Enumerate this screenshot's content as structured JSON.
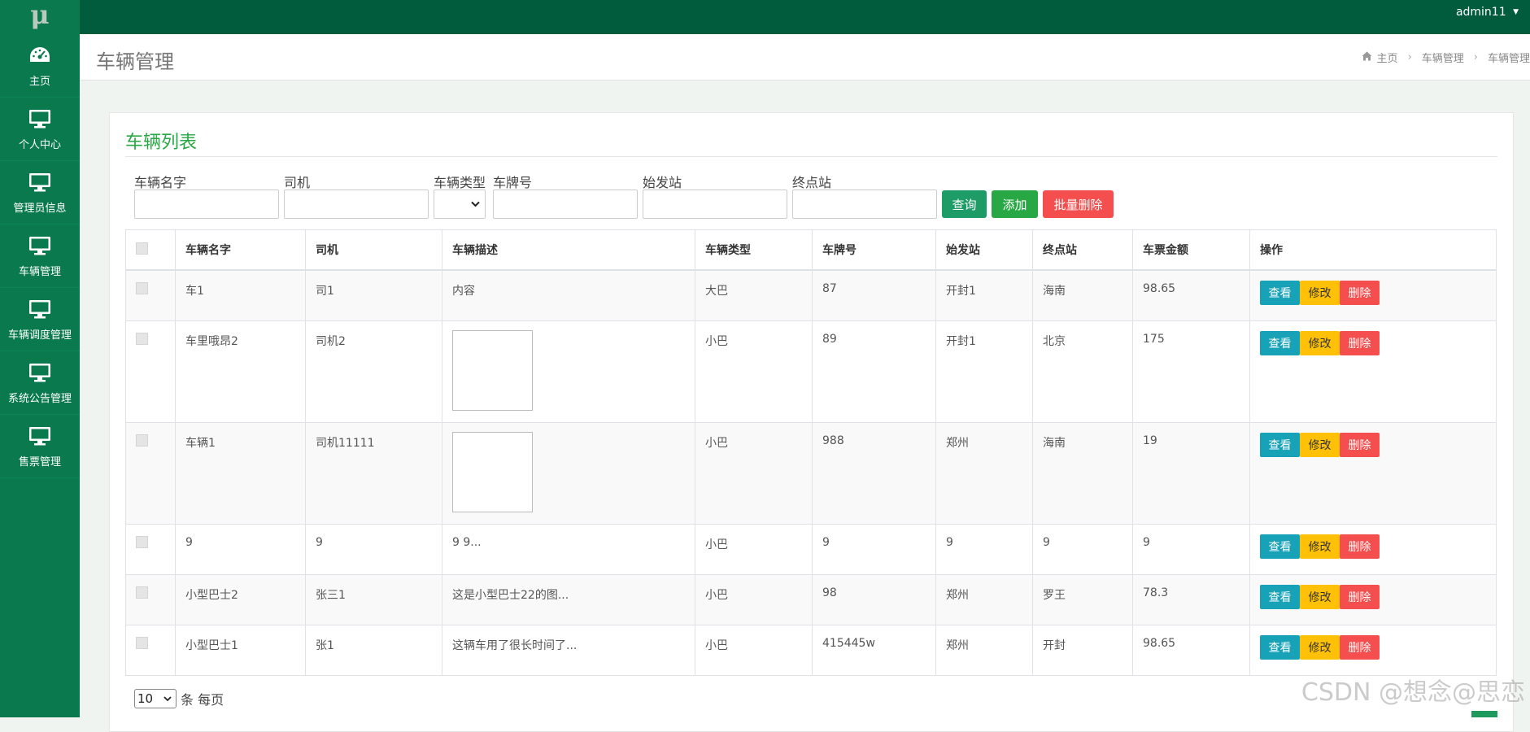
{
  "app": {
    "logo": "μ",
    "user": "admin11"
  },
  "sidebar": {
    "items": [
      {
        "label": "主页",
        "icon": "dashboard-icon"
      },
      {
        "label": "个人中心",
        "icon": "monitor-icon"
      },
      {
        "label": "管理员信息",
        "icon": "monitor-icon"
      },
      {
        "label": "车辆管理",
        "icon": "monitor-icon"
      },
      {
        "label": "车辆调度管理",
        "icon": "monitor-icon"
      },
      {
        "label": "系统公告管理",
        "icon": "monitor-icon"
      },
      {
        "label": "售票管理",
        "icon": "monitor-icon"
      }
    ]
  },
  "header": {
    "title": "车辆管理",
    "breadcrumb": [
      "主页",
      "车辆管理",
      "车辆管理"
    ]
  },
  "panel": {
    "title": "车辆列表"
  },
  "filters": {
    "name_label": "车辆名字",
    "driver_label": "司机",
    "type_label": "车辆类型",
    "plate_label": "车牌号",
    "start_label": "始发站",
    "end_label": "终点站",
    "name_value": "",
    "driver_value": "",
    "type_value": "",
    "plate_value": "",
    "start_value": "",
    "end_value": ""
  },
  "actions": {
    "search": "查询",
    "add": "添加",
    "batch_delete": "批量删除"
  },
  "table": {
    "headers": [
      "车辆名字",
      "司机",
      "车辆描述",
      "车辆类型",
      "车牌号",
      "始发站",
      "终点站",
      "车票金额",
      "操作"
    ],
    "rows": [
      {
        "name": "车1",
        "driver": "司1",
        "desc": "内容",
        "type": "大巴",
        "plate": "87",
        "start": "开封1",
        "end": "海南",
        "price": "98.65"
      },
      {
        "name": "车里哦昂2",
        "driver": "司机2",
        "desc": "",
        "type": "小巴",
        "plate": "89",
        "start": "开封1",
        "end": "北京",
        "price": "175"
      },
      {
        "name": "车辆1",
        "driver": "司机11111",
        "desc": "",
        "type": "小巴",
        "plate": "988",
        "start": "郑州",
        "end": "海南",
        "price": "19"
      },
      {
        "name": "9",
        "driver": "9",
        "desc": "9 9...",
        "type": "小巴",
        "plate": "9",
        "start": "9",
        "end": "9",
        "price": "9"
      },
      {
        "name": "小型巴士2",
        "driver": "张三1",
        "desc": "这是小型巴士22的图...",
        "type": "小巴",
        "plate": "98",
        "start": "郑州",
        "end": "罗王",
        "price": "78.3"
      },
      {
        "name": "小型巴士1",
        "driver": "张1",
        "desc": "这辆车用了很长时间了...",
        "type": "小巴",
        "plate": "415445w",
        "start": "郑州",
        "end": "开封",
        "price": "98.65"
      }
    ],
    "row_actions": {
      "view": "查看",
      "edit": "修改",
      "delete": "删除"
    }
  },
  "pager": {
    "page_size": "10",
    "suffix": "条 每页"
  },
  "watermark": "CSDN @想念@思恋",
  "colors": {
    "sidebar": "#0a7a4e",
    "topbar": "#005c3c",
    "accent": "#28a745",
    "info": "#17a2b8",
    "warning": "#ffc107",
    "danger": "#f44e4e"
  }
}
